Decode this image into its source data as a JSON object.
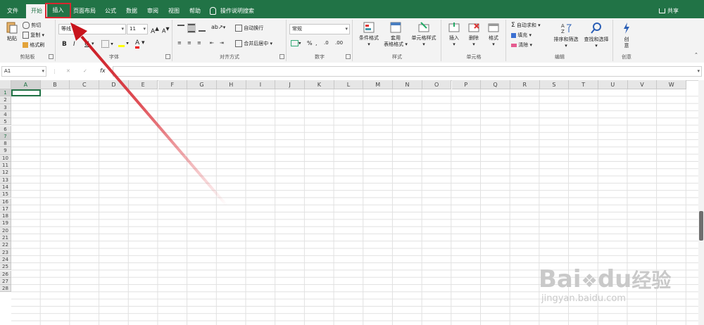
{
  "tabs": [
    "文件",
    "开始",
    "插入",
    "页面布局",
    "公式",
    "数据",
    "审阅",
    "视图",
    "帮助"
  ],
  "tell_me": "操作说明搜索",
  "share": "共享",
  "clipboard": {
    "paste": "粘贴",
    "cut": "剪切",
    "copy": "复制",
    "format_painter": "格式刷",
    "label": "剪贴板"
  },
  "font": {
    "name": "等线",
    "size": "11",
    "bold": "B",
    "italic": "I",
    "underline": "U",
    "grow": "A",
    "shrink": "A",
    "label": "字体"
  },
  "alignment": {
    "wrap": "自动换行",
    "merge": "合并后居中",
    "label": "对齐方式"
  },
  "number": {
    "format": "常规",
    "percent": "%",
    "comma": ",",
    "label": "数字"
  },
  "styles": {
    "conditional": "条件格式",
    "table_line1": "套用",
    "table_line2": "表格格式",
    "cell_styles": "单元格样式",
    "label": "样式"
  },
  "cells": {
    "insert": "插入",
    "delete": "删除",
    "format": "格式",
    "label": "单元格"
  },
  "editing": {
    "autosum": "自动求和",
    "fill": "填充",
    "clear": "清除",
    "sort": "排序和筛选",
    "find": "查找和选择",
    "label": "编辑"
  },
  "ideas": {
    "line1": "创",
    "line2": "意",
    "label": "创意"
  },
  "formula_bar": {
    "name_box": "A1",
    "fx": "fx",
    "cancel": "✕",
    "enter": "✓"
  },
  "columns": [
    "A",
    "B",
    "C",
    "D",
    "E",
    "F",
    "G",
    "H",
    "I",
    "J",
    "K",
    "L",
    "M",
    "N",
    "O",
    "P",
    "Q",
    "R",
    "S",
    "T",
    "U",
    "V",
    "W"
  ],
  "rows": [
    "1",
    "2",
    "3",
    "4",
    "5",
    "6",
    "7",
    "8",
    "9",
    "10",
    "11",
    "12",
    "13",
    "14",
    "15",
    "16",
    "17",
    "18",
    "19",
    "20",
    "21",
    "22",
    "23",
    "24",
    "25",
    "26",
    "27",
    "28"
  ],
  "watermark": {
    "logo_text": "Bai",
    "logo_text2": "du",
    "brand": "经验",
    "url": "jingyan.baidu.com"
  },
  "colors": {
    "accent": "#217346",
    "highlight": "#d9262f"
  }
}
